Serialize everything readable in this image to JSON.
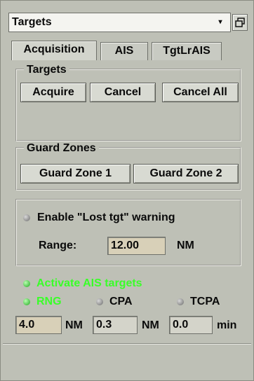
{
  "panel": {
    "title": "Targets",
    "dropdown_caret": "▾",
    "restore_icon": "window-restore-icon"
  },
  "tabs": [
    {
      "label": "Acquisition",
      "active": true
    },
    {
      "label": "AIS",
      "active": false
    },
    {
      "label": "TgtLrAIS",
      "active": false
    }
  ],
  "targets_group": {
    "label": "Targets",
    "buttons": [
      "Acquire",
      "Cancel",
      "Cancel All"
    ]
  },
  "guard_zones_group": {
    "label": "Guard Zones",
    "buttons": [
      "Guard Zone 1",
      "Guard Zone 2"
    ]
  },
  "lost_target": {
    "label": "Enable \"Lost tgt\" warning",
    "enabled": false,
    "range_label": "Range:",
    "range_value": "12.00",
    "range_unit": "NM"
  },
  "ais_targets": {
    "activate_label": "Activate AIS targets",
    "activate_on": true,
    "options": [
      {
        "label": "RNG",
        "selected": true
      },
      {
        "label": "CPA",
        "selected": false
      },
      {
        "label": "TCPA",
        "selected": false
      }
    ],
    "fields": [
      {
        "value": "4.0",
        "unit": "NM"
      },
      {
        "value": "0.3",
        "unit": "NM"
      },
      {
        "value": "0.0",
        "unit": "min"
      }
    ]
  },
  "colors": {
    "background": "#bec0b6",
    "active_green": "#39ff28"
  }
}
